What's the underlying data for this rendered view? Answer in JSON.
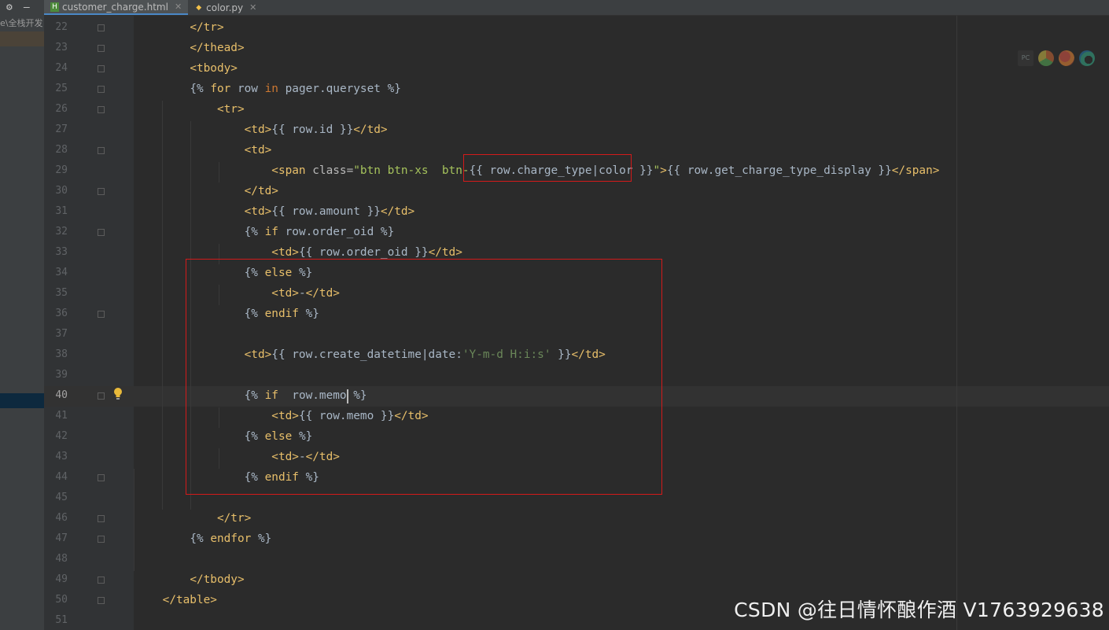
{
  "left_panel": {
    "path_text": "e\\全栈开发"
  },
  "tabs": [
    {
      "label": "customer_charge.html",
      "active": true,
      "icon": "html-file-icon"
    },
    {
      "label": "color.py",
      "active": false,
      "icon": "python-file-icon"
    }
  ],
  "editor": {
    "current_line": 40,
    "lines": [
      {
        "n": "22",
        "html": "        <span class='tag'>&lt;/tr&gt;</span>"
      },
      {
        "n": "23",
        "html": "        <span class='tag'>&lt;/thead&gt;</span>"
      },
      {
        "n": "24",
        "html": "        <span class='tag'>&lt;tbody&gt;</span>"
      },
      {
        "n": "25",
        "html": "        <span class='tpl'>{% </span><span class='tkw'>for</span> row <span class='kw'>in</span> pager.queryset <span class='tpl'>%}</span>"
      },
      {
        "n": "26",
        "html": "            <span class='tag'>&lt;tr&gt;</span>"
      },
      {
        "n": "27",
        "html": "                <span class='tag'>&lt;td&gt;</span>{{ row.id }}<span class='tag'>&lt;/td&gt;</span>"
      },
      {
        "n": "28",
        "html": "                <span class='tag'>&lt;td&gt;</span>"
      },
      {
        "n": "29",
        "html": "                    <span class='tag'>&lt;span </span><span class='attr'>class=</span><span class='str'>\"btn btn-xs  btn-</span>{{ row.charge_type|color }}<span class='str'>\"</span><span class='tag'>&gt;</span>{{ row.get_charge_type_display }}<span class='tag'>&lt;/span&gt;</span>"
      },
      {
        "n": "30",
        "html": "                <span class='tag'>&lt;/td&gt;</span>"
      },
      {
        "n": "31",
        "html": "                <span class='tag'>&lt;td&gt;</span>{{ row.amount }}<span class='tag'>&lt;/td&gt;</span>"
      },
      {
        "n": "32",
        "html": "                <span class='tpl'>{% </span><span class='tkw'>if</span> row.order_oid <span class='tpl'>%}</span>"
      },
      {
        "n": "33",
        "html": "                    <span class='tag'>&lt;td&gt;</span>{{ row.order_oid }}<span class='tag'>&lt;/td&gt;</span>"
      },
      {
        "n": "34",
        "html": "                <span class='tpl'>{% </span><span class='tkw'>else</span> <span class='tpl'>%}</span>"
      },
      {
        "n": "35",
        "html": "                    <span class='tag'>&lt;td&gt;</span>-<span class='tag'>&lt;/td&gt;</span>"
      },
      {
        "n": "36",
        "html": "                <span class='tpl'>{% </span><span class='tkw'>endif</span> <span class='tpl'>%}</span>"
      },
      {
        "n": "37",
        "html": ""
      },
      {
        "n": "38",
        "html": "                <span class='tag'>&lt;td&gt;</span>{{ row.create_datetime|date:<span class='sq'>'Y-m-d H:i:s'</span> }}<span class='tag'>&lt;/td&gt;</span>"
      },
      {
        "n": "39",
        "html": ""
      },
      {
        "n": "40",
        "html": "                <span class='tpl'>{% </span><span class='tkw'>if</span>  row.memo <span class='tpl'>%}</span>"
      },
      {
        "n": "41",
        "html": "                    <span class='tag'>&lt;td&gt;</span>{{ row.memo }}<span class='tag'>&lt;/td&gt;</span>"
      },
      {
        "n": "42",
        "html": "                <span class='tpl'>{% </span><span class='tkw'>else</span> <span class='tpl'>%}</span>"
      },
      {
        "n": "43",
        "html": "                    <span class='tag'>&lt;td&gt;</span>-<span class='tag'>&lt;/td&gt;</span>"
      },
      {
        "n": "44",
        "html": "                <span class='tpl'>{% </span><span class='tkw'>endif</span> <span class='tpl'>%}</span>"
      },
      {
        "n": "45",
        "html": ""
      },
      {
        "n": "46",
        "html": "            <span class='tag'>&lt;/tr&gt;</span>"
      },
      {
        "n": "47",
        "html": "        <span class='tpl'>{% </span><span class='tkw'>endfor</span> <span class='tpl'>%}</span>"
      },
      {
        "n": "48",
        "html": ""
      },
      {
        "n": "49",
        "html": "        <span class='tag'>&lt;/tbody&gt;</span>"
      },
      {
        "n": "50",
        "html": "    <span class='tag'>&lt;/table&gt;</span>"
      },
      {
        "n": "51",
        "html": ""
      }
    ]
  },
  "browser_icons": [
    "pycharm-icon",
    "chrome-icon",
    "firefox-icon",
    "edge-icon"
  ],
  "watermark": "CSDN @往日情怀酿作酒 V1763929638"
}
